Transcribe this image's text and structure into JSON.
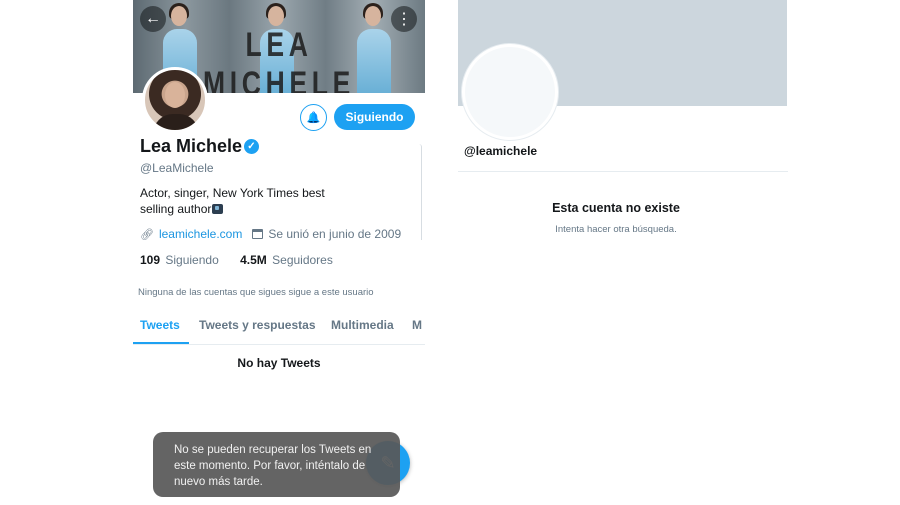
{
  "left": {
    "banner_title": "LEA MICHELE",
    "profile": {
      "display_name": "Lea Michele",
      "verified_glyph": "✓",
      "handle": "@LeaMichele",
      "bio_line1": "Actor, singer, New York Times best",
      "bio_line2": "selling author",
      "website": "leamichele.com",
      "joined": "Se unió en junio de 2009",
      "following_count": "109",
      "following_label": "Siguiendo",
      "followers_count": "4.5M",
      "followers_label": "Seguidores",
      "followers_note": "Ninguna de las cuentas que sigues sigue a este usuario"
    },
    "buttons": {
      "following": "Siguiendo",
      "back_glyph": "←",
      "more_glyph": "⋮",
      "notify_glyph": "🔔"
    },
    "tabs": [
      {
        "label": "Tweets",
        "active": true
      },
      {
        "label": "Tweets y respuestas",
        "active": false
      },
      {
        "label": "Multimedia",
        "active": false
      },
      {
        "label": "M",
        "active": false
      }
    ],
    "empty_state": "No hay Tweets",
    "toast": {
      "line1": "No se pueden recuperar los Tweets en",
      "line2": "este momento. Por favor, inténtalo de",
      "line3": "nuevo más tarde."
    },
    "fab_glyph": "✎"
  },
  "right": {
    "handle": "@leamichele",
    "error_title": "Esta cuenta no existe",
    "error_subtitle": "Intenta hacer otra búsqueda."
  },
  "colors": {
    "accent": "#1da1f2",
    "link": "#1b95e0",
    "muted_text": "#657786",
    "empty_banner": "#ccd6dd",
    "toast_bg": "#585858"
  },
  "icons": [
    "back-arrow-icon",
    "more-icon",
    "notification-bell-icon",
    "verified-badge-icon",
    "link-icon",
    "calendar-icon",
    "compose-icon"
  ]
}
